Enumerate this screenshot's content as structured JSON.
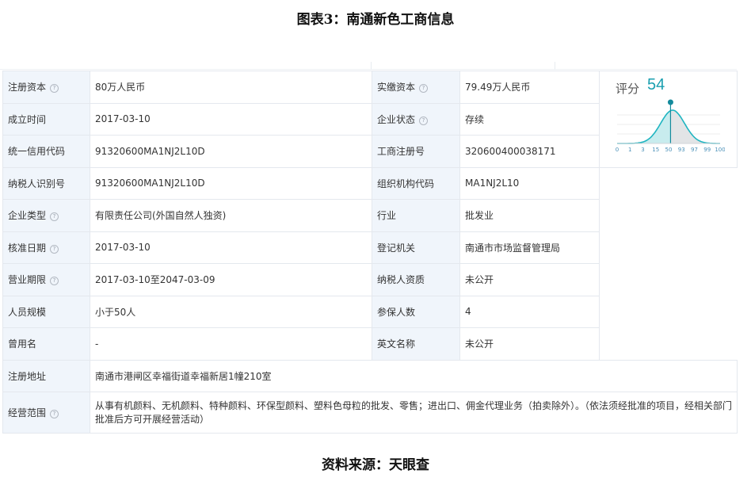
{
  "title": "图表3：南通新色工商信息",
  "source": "资料来源：天眼查",
  "colors": {
    "label_bg": "#f0f5fb",
    "border": "#e4e8ee",
    "accent": "#1a9fb0"
  },
  "score": {
    "label": "评分",
    "value": "54",
    "ticks": [
      "0",
      "1",
      "3",
      "15",
      "50",
      "93",
      "97",
      "99",
      "100"
    ]
  },
  "rows": [
    {
      "l1": "注册资本",
      "i1": true,
      "v1": "80万人民币",
      "l2": "实缴资本",
      "i2": true,
      "v2": "79.49万人民币"
    },
    {
      "l1": "成立时间",
      "i1": false,
      "v1": "2017-03-10",
      "l2": "企业状态",
      "i2": true,
      "v2": "存续"
    },
    {
      "l1": "统一信用代码",
      "i1": false,
      "v1": "91320600MA1NJ2L10D",
      "l2": "工商注册号",
      "i2": false,
      "v2": "320600400038171"
    },
    {
      "l1": "纳税人识别号",
      "i1": false,
      "v1": "91320600MA1NJ2L10D",
      "l2": "组织机构代码",
      "i2": false,
      "v2": "MA1NJ2L10"
    },
    {
      "l1": "企业类型",
      "i1": true,
      "v1": "有限责任公司(外国自然人独资)",
      "l2": "行业",
      "i2": false,
      "v2": "批发业"
    },
    {
      "l1": "核准日期",
      "i1": true,
      "v1": "2017-03-10",
      "l2": "登记机关",
      "i2": false,
      "v2": "南通市市场监督管理局"
    },
    {
      "l1": "营业期限",
      "i1": true,
      "v1": "2017-03-10至2047-03-09",
      "l2": "纳税人资质",
      "i2": false,
      "v2": "未公开"
    },
    {
      "l1": "人员规模",
      "i1": false,
      "v1": "小于50人",
      "l2": "参保人数",
      "i2": false,
      "v2": "4"
    },
    {
      "l1": "曾用名",
      "i1": false,
      "v1": "-",
      "l2": "英文名称",
      "i2": false,
      "v2": "未公开"
    }
  ],
  "address": {
    "label": "注册地址",
    "value": "南通市港闸区幸福街道幸福新居1幢210室"
  },
  "scope": {
    "label": "经营范围",
    "value": "从事有机颜料、无机颜料、特种颜料、环保型颜料、塑料色母粒的批发、零售；进出口、佣金代理业务（拍卖除外）。（依法须经批准的项目，经相关部门批准后方可开展经营活动）"
  }
}
